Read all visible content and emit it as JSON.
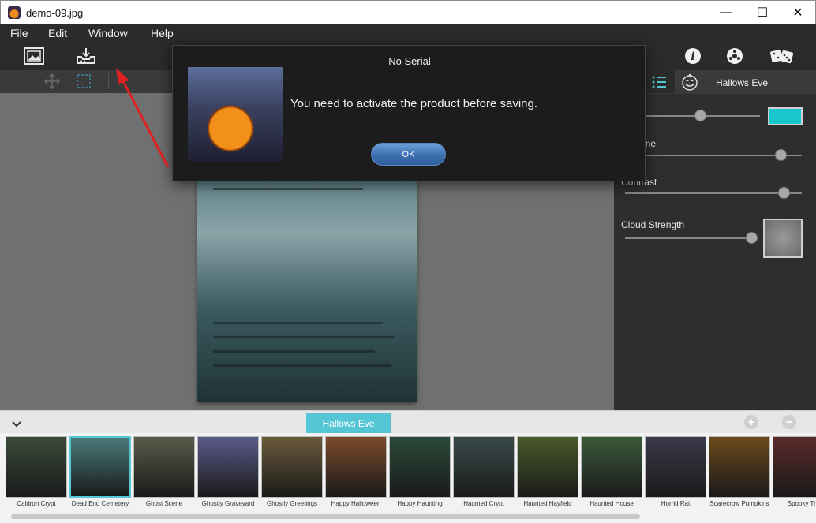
{
  "window": {
    "title": "demo-09.jpg",
    "controls": {
      "minimize": "—",
      "maximize": "☐",
      "close": "✕"
    }
  },
  "menu": [
    "File",
    "Edit",
    "Window",
    "Help"
  ],
  "toolbar": {
    "left_icons": [
      "image-icon",
      "download-save-icon"
    ],
    "right_icons": [
      "info-icon",
      "settings-icon",
      "dice-icon"
    ],
    "sub_icons": [
      "move-icon",
      "crop-select-icon"
    ]
  },
  "right_panel": {
    "tabs": [
      "list-icon",
      "pumpkin-icon"
    ],
    "preset_name": "Hallows Eve",
    "params": [
      {
        "label": "",
        "value": 0.6,
        "swatch_color": "#19c6cc"
      },
      {
        "label": "n Scene",
        "value": 0.88
      },
      {
        "label": "Contrast",
        "value": 0.9
      },
      {
        "label": "Cloud Strength",
        "value": 0.93,
        "swatch_color": "#7f7f7f"
      }
    ]
  },
  "dialog": {
    "title": "No Serial",
    "message": "You need to activate the product before saving.",
    "ok_label": "OK"
  },
  "bottom": {
    "category_tab": "Hallows Eve",
    "add_label": "+",
    "remove_label": "−",
    "thumbnails": [
      {
        "label": "Caldron Crypt",
        "color": "#3a4a3a"
      },
      {
        "label": "Dead End Cemetery",
        "color": "#4a7a7a",
        "selected": true
      },
      {
        "label": "Ghost Scene",
        "color": "#5a5a4a"
      },
      {
        "label": "Ghostly Graveyard",
        "color": "#5a5a8a"
      },
      {
        "label": "Ghostly Greetings",
        "color": "#6a5a3a"
      },
      {
        "label": "Happy Halloween",
        "color": "#7a4a2a"
      },
      {
        "label": "Happy Haunting",
        "color": "#2a4a3a"
      },
      {
        "label": "Haunted Crypt",
        "color": "#3a4a4a"
      },
      {
        "label": "Haunted Hayfield",
        "color": "#4a5a2a"
      },
      {
        "label": "Haunted House",
        "color": "#3a5a3a"
      },
      {
        "label": "Horrid Rat",
        "color": "#3a3a4a"
      },
      {
        "label": "Scarecrow Pumpkins",
        "color": "#6a4a1a"
      },
      {
        "label": "Spooky Tre",
        "color": "#5a2a2a"
      }
    ]
  }
}
